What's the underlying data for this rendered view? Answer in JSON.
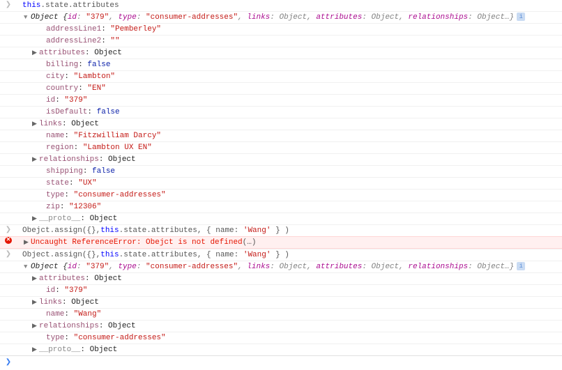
{
  "lines": [
    {
      "kind": "input",
      "indent": 0,
      "tri": "none",
      "tokens": [
        {
          "t": "this",
          "c": "k-this"
        },
        {
          "t": ".state.attributes",
          "c": "k-prop"
        }
      ]
    },
    {
      "kind": "result",
      "indent": 12,
      "tri": "open",
      "tokens": [
        {
          "t": "Object {",
          "c": "k-objbrace"
        },
        {
          "t": "id",
          "c": "k-objkey"
        },
        {
          "t": ": ",
          "c": "k-objval"
        },
        {
          "t": "\"379\"",
          "c": "k-str"
        },
        {
          "t": ", ",
          "c": "k-objval"
        },
        {
          "t": "type",
          "c": "k-objkey"
        },
        {
          "t": ": ",
          "c": "k-objval"
        },
        {
          "t": "\"consumer-addresses\"",
          "c": "k-str"
        },
        {
          "t": ", ",
          "c": "k-objval"
        },
        {
          "t": "links",
          "c": "k-objkey"
        },
        {
          "t": ": Object, ",
          "c": "k-objval"
        },
        {
          "t": "attributes",
          "c": "k-objkey"
        },
        {
          "t": ": Object, ",
          "c": "k-objval"
        },
        {
          "t": "relationships",
          "c": "k-objkey"
        },
        {
          "t": ": Object…}",
          "c": "k-objval"
        },
        {
          "t": "i",
          "c": "info-badge"
        }
      ]
    },
    {
      "kind": "plain",
      "indent": 34,
      "tri": "none",
      "tokens": [
        {
          "t": "addressLine1",
          "c": "k-key"
        },
        {
          "t": ": ",
          "c": "k-punct"
        },
        {
          "t": "\"Pemberley\"",
          "c": "k-str"
        }
      ]
    },
    {
      "kind": "plain",
      "indent": 34,
      "tri": "none",
      "tokens": [
        {
          "t": "addressLine2",
          "c": "k-key"
        },
        {
          "t": ": ",
          "c": "k-punct"
        },
        {
          "t": "\"\"",
          "c": "k-str"
        }
      ]
    },
    {
      "kind": "plain",
      "indent": 24,
      "tri": "closed",
      "tokens": [
        {
          "t": "attributes",
          "c": "k-key"
        },
        {
          "t": ": ",
          "c": "k-punct"
        },
        {
          "t": "Object",
          "c": "k-objlbl"
        }
      ]
    },
    {
      "kind": "plain",
      "indent": 34,
      "tri": "none",
      "tokens": [
        {
          "t": "billing",
          "c": "k-key"
        },
        {
          "t": ": ",
          "c": "k-punct"
        },
        {
          "t": "false",
          "c": "k-bool"
        }
      ]
    },
    {
      "kind": "plain",
      "indent": 34,
      "tri": "none",
      "tokens": [
        {
          "t": "city",
          "c": "k-key"
        },
        {
          "t": ": ",
          "c": "k-punct"
        },
        {
          "t": "\"Lambton\"",
          "c": "k-str"
        }
      ]
    },
    {
      "kind": "plain",
      "indent": 34,
      "tri": "none",
      "tokens": [
        {
          "t": "country",
          "c": "k-key"
        },
        {
          "t": ": ",
          "c": "k-punct"
        },
        {
          "t": "\"EN\"",
          "c": "k-str"
        }
      ]
    },
    {
      "kind": "plain",
      "indent": 34,
      "tri": "none",
      "tokens": [
        {
          "t": "id",
          "c": "k-key"
        },
        {
          "t": ": ",
          "c": "k-punct"
        },
        {
          "t": "\"379\"",
          "c": "k-str"
        }
      ]
    },
    {
      "kind": "plain",
      "indent": 34,
      "tri": "none",
      "tokens": [
        {
          "t": "isDefault",
          "c": "k-key"
        },
        {
          "t": ": ",
          "c": "k-punct"
        },
        {
          "t": "false",
          "c": "k-bool"
        }
      ]
    },
    {
      "kind": "plain",
      "indent": 24,
      "tri": "closed",
      "tokens": [
        {
          "t": "links",
          "c": "k-key"
        },
        {
          "t": ": ",
          "c": "k-punct"
        },
        {
          "t": "Object",
          "c": "k-objlbl"
        }
      ]
    },
    {
      "kind": "plain",
      "indent": 34,
      "tri": "none",
      "tokens": [
        {
          "t": "name",
          "c": "k-key"
        },
        {
          "t": ": ",
          "c": "k-punct"
        },
        {
          "t": "\"Fitzwilliam Darcy\"",
          "c": "k-str"
        }
      ]
    },
    {
      "kind": "plain",
      "indent": 34,
      "tri": "none",
      "tokens": [
        {
          "t": "region",
          "c": "k-key"
        },
        {
          "t": ": ",
          "c": "k-punct"
        },
        {
          "t": "\"Lambton UX EN\"",
          "c": "k-str"
        }
      ]
    },
    {
      "kind": "plain",
      "indent": 24,
      "tri": "closed",
      "tokens": [
        {
          "t": "relationships",
          "c": "k-key"
        },
        {
          "t": ": ",
          "c": "k-punct"
        },
        {
          "t": "Object",
          "c": "k-objlbl"
        }
      ]
    },
    {
      "kind": "plain",
      "indent": 34,
      "tri": "none",
      "tokens": [
        {
          "t": "shipping",
          "c": "k-key"
        },
        {
          "t": ": ",
          "c": "k-punct"
        },
        {
          "t": "false",
          "c": "k-bool"
        }
      ]
    },
    {
      "kind": "plain",
      "indent": 34,
      "tri": "none",
      "tokens": [
        {
          "t": "state",
          "c": "k-key"
        },
        {
          "t": ": ",
          "c": "k-punct"
        },
        {
          "t": "\"UX\"",
          "c": "k-str"
        }
      ]
    },
    {
      "kind": "plain",
      "indent": 34,
      "tri": "none",
      "tokens": [
        {
          "t": "type",
          "c": "k-key"
        },
        {
          "t": ": ",
          "c": "k-punct"
        },
        {
          "t": "\"consumer-addresses\"",
          "c": "k-str"
        }
      ]
    },
    {
      "kind": "plain",
      "indent": 34,
      "tri": "none",
      "tokens": [
        {
          "t": "zip",
          "c": "k-key"
        },
        {
          "t": ": ",
          "c": "k-punct"
        },
        {
          "t": "\"12306\"",
          "c": "k-str"
        }
      ]
    },
    {
      "kind": "plain",
      "indent": 24,
      "tri": "closed",
      "tokens": [
        {
          "t": "__proto__",
          "c": "k-dim"
        },
        {
          "t": ": ",
          "c": "k-punct"
        },
        {
          "t": "Object",
          "c": "k-objlbl"
        }
      ]
    },
    {
      "kind": "input",
      "indent": 0,
      "tri": "none",
      "tokens": [
        {
          "t": "Obejct.assign({},",
          "c": "k-prop"
        },
        {
          "t": "this",
          "c": "k-this"
        },
        {
          "t": ".state.attributes, { name: ",
          "c": "k-prop"
        },
        {
          "t": "'Wang'",
          "c": "k-str"
        },
        {
          "t": " } )",
          "c": "k-prop"
        }
      ]
    },
    {
      "kind": "error",
      "indent": 12,
      "tri": "closed",
      "tokens": [
        {
          "t": "Uncaught ReferenceError: Obejct is not defined",
          "c": "k-err"
        },
        {
          "t": "(…)",
          "c": "k-prop"
        }
      ]
    },
    {
      "kind": "input",
      "indent": 0,
      "tri": "none",
      "tokens": [
        {
          "t": "Object.assign({},",
          "c": "k-prop"
        },
        {
          "t": "this",
          "c": "k-this"
        },
        {
          "t": ".state.attributes, { name: ",
          "c": "k-prop"
        },
        {
          "t": "'Wang'",
          "c": "k-str"
        },
        {
          "t": " } )",
          "c": "k-prop"
        }
      ]
    },
    {
      "kind": "result",
      "indent": 12,
      "tri": "open",
      "tokens": [
        {
          "t": "Object {",
          "c": "k-objbrace"
        },
        {
          "t": "id",
          "c": "k-objkey"
        },
        {
          "t": ": ",
          "c": "k-objval"
        },
        {
          "t": "\"379\"",
          "c": "k-str"
        },
        {
          "t": ", ",
          "c": "k-objval"
        },
        {
          "t": "type",
          "c": "k-objkey"
        },
        {
          "t": ": ",
          "c": "k-objval"
        },
        {
          "t": "\"consumer-addresses\"",
          "c": "k-str"
        },
        {
          "t": ", ",
          "c": "k-objval"
        },
        {
          "t": "links",
          "c": "k-objkey"
        },
        {
          "t": ": Object, ",
          "c": "k-objval"
        },
        {
          "t": "attributes",
          "c": "k-objkey"
        },
        {
          "t": ": Object, ",
          "c": "k-objval"
        },
        {
          "t": "relationships",
          "c": "k-objkey"
        },
        {
          "t": ": Object…}",
          "c": "k-objval"
        },
        {
          "t": "i",
          "c": "info-badge"
        }
      ]
    },
    {
      "kind": "plain",
      "indent": 24,
      "tri": "closed",
      "tokens": [
        {
          "t": "attributes",
          "c": "k-key"
        },
        {
          "t": ": ",
          "c": "k-punct"
        },
        {
          "t": "Object",
          "c": "k-objlbl"
        }
      ]
    },
    {
      "kind": "plain",
      "indent": 34,
      "tri": "none",
      "tokens": [
        {
          "t": "id",
          "c": "k-key"
        },
        {
          "t": ": ",
          "c": "k-punct"
        },
        {
          "t": "\"379\"",
          "c": "k-str"
        }
      ]
    },
    {
      "kind": "plain",
      "indent": 24,
      "tri": "closed",
      "tokens": [
        {
          "t": "links",
          "c": "k-key"
        },
        {
          "t": ": ",
          "c": "k-punct"
        },
        {
          "t": "Object",
          "c": "k-objlbl"
        }
      ]
    },
    {
      "kind": "plain",
      "indent": 34,
      "tri": "none",
      "tokens": [
        {
          "t": "name",
          "c": "k-key"
        },
        {
          "t": ": ",
          "c": "k-punct"
        },
        {
          "t": "\"Wang\"",
          "c": "k-str"
        }
      ]
    },
    {
      "kind": "plain",
      "indent": 24,
      "tri": "closed",
      "tokens": [
        {
          "t": "relationships",
          "c": "k-key"
        },
        {
          "t": ": ",
          "c": "k-punct"
        },
        {
          "t": "Object",
          "c": "k-objlbl"
        }
      ]
    },
    {
      "kind": "plain",
      "indent": 34,
      "tri": "none",
      "tokens": [
        {
          "t": "type",
          "c": "k-key"
        },
        {
          "t": ": ",
          "c": "k-punct"
        },
        {
          "t": "\"consumer-addresses\"",
          "c": "k-str"
        }
      ]
    },
    {
      "kind": "plain",
      "indent": 24,
      "tri": "closed",
      "tokens": [
        {
          "t": "__proto__",
          "c": "k-dim"
        },
        {
          "t": ": ",
          "c": "k-punct"
        },
        {
          "t": "Object",
          "c": "k-objlbl"
        }
      ]
    }
  ],
  "prompt": {
    "icon": "❯"
  }
}
